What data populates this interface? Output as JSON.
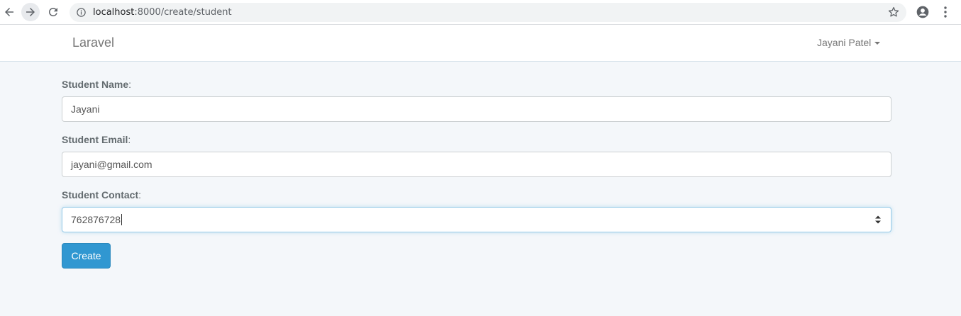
{
  "browser": {
    "url_host": "localhost",
    "url_path": ":8000/create/student"
  },
  "navbar": {
    "brand": "Laravel",
    "user_name": "Jayani Patel"
  },
  "form": {
    "name_label": "Student Name",
    "name_value": "Jayani",
    "email_label": "Student Email",
    "email_value": "jayani@gmail.com",
    "contact_label": "Student Contact",
    "contact_value": "762876728",
    "submit_label": "Create"
  },
  "colors": {
    "primary_button": "#3097d1",
    "page_background": "#f4f7fa"
  }
}
